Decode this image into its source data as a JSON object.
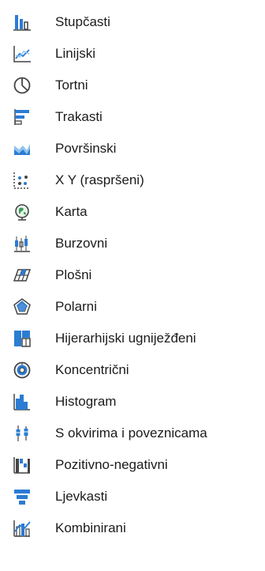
{
  "chart_types": {
    "items": [
      {
        "label": "Stupčasti",
        "icon": "column-chart-icon"
      },
      {
        "label": "Linijski",
        "icon": "line-chart-icon"
      },
      {
        "label": "Tortni",
        "icon": "pie-chart-icon"
      },
      {
        "label": "Trakasti",
        "icon": "bar-chart-icon"
      },
      {
        "label": "Površinski",
        "icon": "area-chart-icon"
      },
      {
        "label": "X Y (raspršeni)",
        "icon": "scatter-chart-icon"
      },
      {
        "label": "Karta",
        "icon": "map-chart-icon"
      },
      {
        "label": "Burzovni",
        "icon": "stock-chart-icon"
      },
      {
        "label": "Plošni",
        "icon": "surface-chart-icon"
      },
      {
        "label": "Polarni",
        "icon": "radar-chart-icon"
      },
      {
        "label": "Hijerarhijski ugniježđeni",
        "icon": "treemap-chart-icon"
      },
      {
        "label": "Koncentrični",
        "icon": "sunburst-chart-icon"
      },
      {
        "label": "Histogram",
        "icon": "histogram-chart-icon"
      },
      {
        "label": "S okvirima i poveznicama",
        "icon": "box-whisker-chart-icon"
      },
      {
        "label": "Pozitivno-negativni",
        "icon": "waterfall-chart-icon"
      },
      {
        "label": "Ljevkasti",
        "icon": "funnel-chart-icon"
      },
      {
        "label": "Kombinirani",
        "icon": "combo-chart-icon"
      }
    ]
  },
  "colors": {
    "accent_blue": "#2b7cd3",
    "dark_gray": "#444444",
    "light_blue": "#8fc3ee"
  }
}
